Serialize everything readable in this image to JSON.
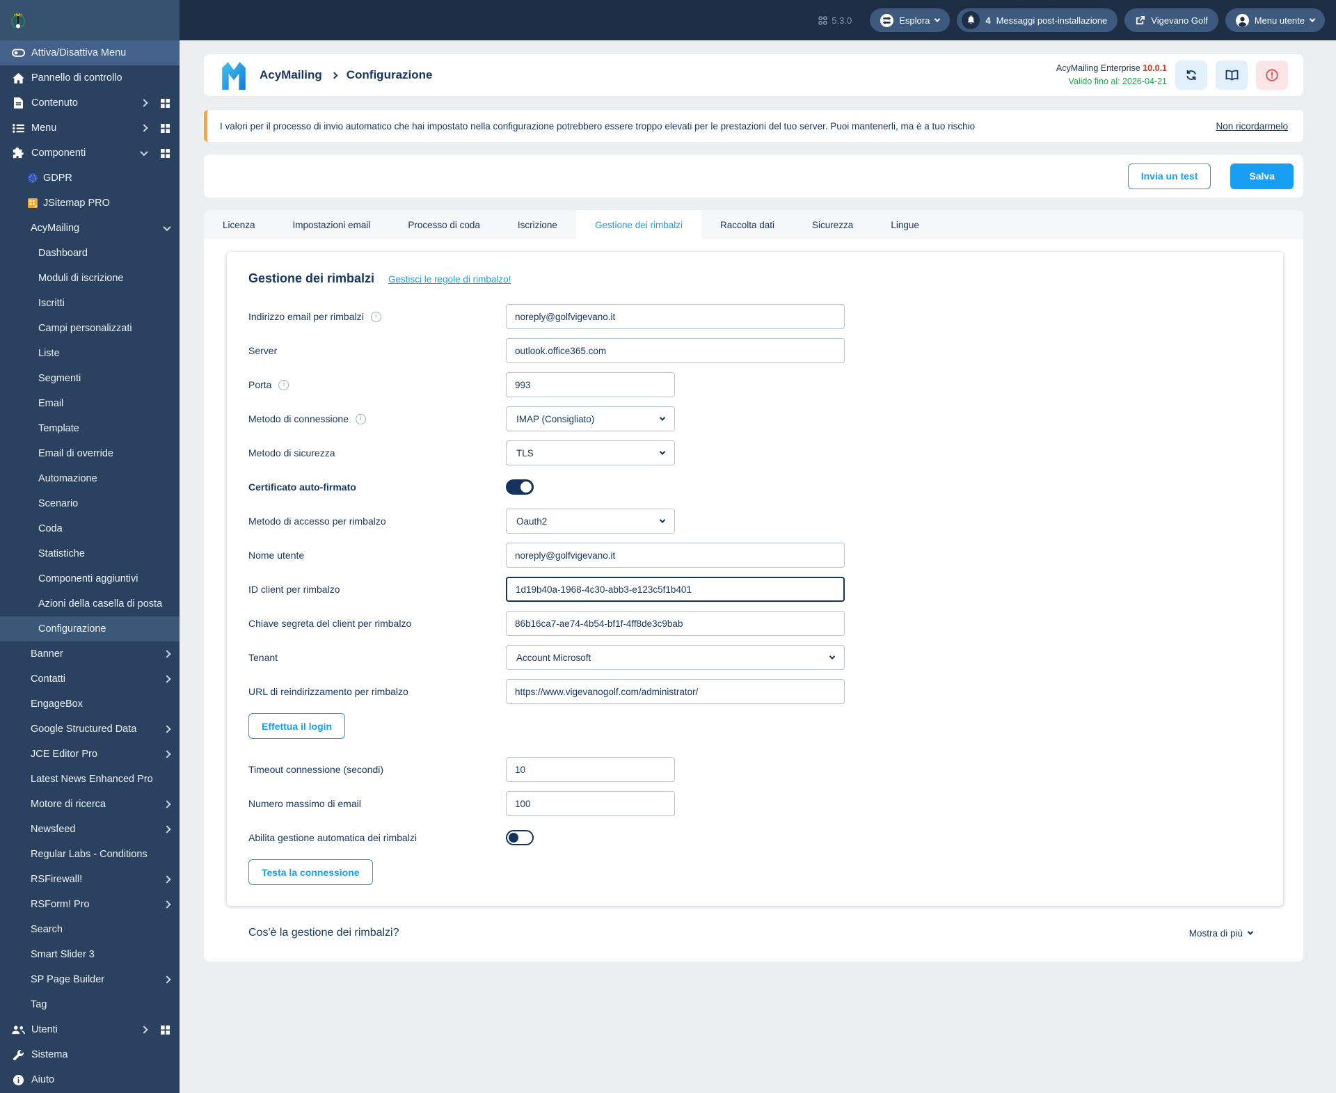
{
  "topbar": {
    "version": "5.3.0",
    "explore_label": "Esplora",
    "messages_count": "4",
    "messages_label": "Messaggi post-installazione",
    "site_label": "Vigevano Golf",
    "user_menu_label": "Menu utente"
  },
  "sidebar": {
    "items": [
      {
        "label": "Attiva/Disattiva Menu",
        "level": 1,
        "icon": "toggle",
        "active": true
      },
      {
        "label": "Pannello di controllo",
        "level": 1,
        "icon": "home"
      },
      {
        "label": "Contenuto",
        "level": 1,
        "icon": "document",
        "chevron": "right",
        "grid": true
      },
      {
        "label": "Menu",
        "level": 1,
        "icon": "list",
        "chevron": "right",
        "grid": true
      },
      {
        "label": "Componenti",
        "level": 1,
        "icon": "puzzle",
        "chevron": "down",
        "grid": true
      },
      {
        "label": "GDPR",
        "level": 2,
        "icon": "gdpr"
      },
      {
        "label": "JSitemap PRO",
        "level": 2,
        "icon": "jsitemap"
      },
      {
        "label": "AcyMailing",
        "level": 2,
        "chevron": "down"
      },
      {
        "label": "Dashboard",
        "level": 3
      },
      {
        "label": "Moduli di iscrizione",
        "level": 3
      },
      {
        "label": "Iscritti",
        "level": 3
      },
      {
        "label": "Campi personalizzati",
        "level": 3
      },
      {
        "label": "Liste",
        "level": 3
      },
      {
        "label": "Segmenti",
        "level": 3
      },
      {
        "label": "Email",
        "level": 3
      },
      {
        "label": "Template",
        "level": 3
      },
      {
        "label": "Email di override",
        "level": 3
      },
      {
        "label": "Automazione",
        "level": 3
      },
      {
        "label": "Scenario",
        "level": 3
      },
      {
        "label": "Coda",
        "level": 3
      },
      {
        "label": "Statistiche",
        "level": 3
      },
      {
        "label": "Componenti aggiuntivi",
        "level": 3
      },
      {
        "label": "Azioni della casella di posta",
        "level": 3
      },
      {
        "label": "Configurazione",
        "level": 3,
        "active": true
      },
      {
        "label": "Banner",
        "level": 2,
        "chevron": "right"
      },
      {
        "label": "Contatti",
        "level": 2,
        "chevron": "right"
      },
      {
        "label": "EngageBox",
        "level": 2
      },
      {
        "label": "Google Structured Data",
        "level": 2,
        "chevron": "right"
      },
      {
        "label": "JCE Editor Pro",
        "level": 2,
        "chevron": "right"
      },
      {
        "label": "Latest News Enhanced Pro",
        "level": 2
      },
      {
        "label": "Motore di ricerca",
        "level": 2,
        "chevron": "right"
      },
      {
        "label": "Newsfeed",
        "level": 2,
        "chevron": "right"
      },
      {
        "label": "Regular Labs - Conditions",
        "level": 2
      },
      {
        "label": "RSFirewall!",
        "level": 2,
        "chevron": "right"
      },
      {
        "label": "RSForm! Pro",
        "level": 2,
        "chevron": "right"
      },
      {
        "label": "Search",
        "level": 2
      },
      {
        "label": "Smart Slider 3",
        "level": 2
      },
      {
        "label": "SP Page Builder",
        "level": 2,
        "chevron": "right"
      },
      {
        "label": "Tag",
        "level": 2
      },
      {
        "label": "Utenti",
        "level": 1,
        "icon": "users",
        "chevron": "right",
        "grid": true
      },
      {
        "label": "Sistema",
        "level": 1,
        "icon": "wrench"
      },
      {
        "label": "Aiuto",
        "level": 1,
        "icon": "info"
      }
    ]
  },
  "header": {
    "breadcrumb_app": "AcyMailing",
    "breadcrumb_page": "Configurazione",
    "edition": "AcyMailing Enterprise",
    "edition_version": "10.0.1",
    "valid_until": "Valido fino al: 2026-04-21"
  },
  "warning": {
    "text": "I valori per il processo di invio automatico che hai impostato nella configurazione potrebbero essere troppo elevati per le prestazioni del tuo server. Puoi mantenerli, ma è a tuo rischio",
    "dismiss_label": "Non ricordarmelo"
  },
  "toolbar": {
    "test_label": "Invia un test",
    "save_label": "Salva"
  },
  "tabs": {
    "items": [
      "Licenza",
      "Impostazioni email",
      "Processo di coda",
      "Iscrizione",
      "Gestione dei rimbalzi",
      "Raccolta dati",
      "Sicurezza",
      "Lingue"
    ],
    "active": "Gestione dei rimbalzi"
  },
  "form": {
    "title": "Gestione dei rimbalzi",
    "rules_link": "Gestisci le regole di rimbalzo!",
    "fields": [
      {
        "name": "bounce-email",
        "label": "Indirizzo email per rimbalzi",
        "info": true,
        "type": "text",
        "value": "noreply@golfvigevano.it",
        "size": "wide"
      },
      {
        "name": "server",
        "label": "Server",
        "type": "text",
        "value": "outlook.office365.com",
        "size": "wide"
      },
      {
        "name": "port",
        "label": "Porta",
        "info": true,
        "type": "text",
        "value": "993",
        "size": "small"
      },
      {
        "name": "connection-method",
        "label": "Metodo di connessione",
        "info": true,
        "type": "select",
        "value": "IMAP (Consigliato)",
        "size": "small"
      },
      {
        "name": "security-method",
        "label": "Metodo di sicurezza",
        "type": "select",
        "value": "TLS",
        "size": "small"
      },
      {
        "name": "self-signed-certificate",
        "label": "Certificato auto-firmato",
        "type": "toggle",
        "on": true,
        "bold": true
      },
      {
        "name": "bounce-access-method",
        "label": "Metodo di accesso per rimbalzo",
        "type": "select",
        "value": "Oauth2",
        "size": "small"
      },
      {
        "name": "username",
        "label": "Nome utente",
        "type": "text",
        "value": "noreply@golfvigevano.it",
        "size": "wide"
      },
      {
        "name": "bounce-client-id",
        "label": "ID client per rimbalzo",
        "type": "text",
        "value": "1d19b40a-1968-4c30-abb3-e123c5f1b401",
        "size": "wide",
        "focused": true
      },
      {
        "name": "bounce-client-secret",
        "label": "Chiave segreta del client per rimbalzo",
        "type": "text",
        "value": "86b16ca7-ae74-4b54-bf1f-4ff8de3c9bab",
        "size": "wide"
      },
      {
        "name": "tenant",
        "label": "Tenant",
        "type": "select",
        "value": "Account Microsoft",
        "size": "wide"
      },
      {
        "name": "bounce-redirect-url",
        "label": "URL di reindirizzamento per rimbalzo",
        "type": "text",
        "value": "https://www.vigevanogolf.com/administrator/",
        "size": "wide"
      },
      {
        "name": "login",
        "type": "button",
        "value": "Effettua il login"
      },
      {
        "name": "connection-timeout",
        "label": "Timeout connessione (secondi)",
        "type": "text",
        "value": "10",
        "size": "small"
      },
      {
        "name": "max-emails",
        "label": "Numero massimo di email",
        "type": "text",
        "value": "100",
        "size": "small"
      },
      {
        "name": "auto-bounce-handling",
        "label": "Abilita gestione automatica dei rimbalzi",
        "type": "toggle",
        "on": false
      },
      {
        "name": "test-connection",
        "type": "button",
        "value": "Testa la connessione",
        "last": true
      }
    ]
  },
  "faq": {
    "question": "Cos'è la gestione dei rimbalzi?",
    "more_label": "Mostra di più"
  }
}
